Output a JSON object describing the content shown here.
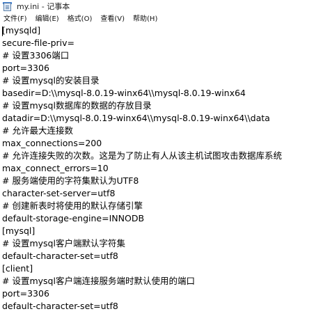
{
  "window": {
    "title": "my.ini - 记事本",
    "icon": "notepad-icon"
  },
  "menu": {
    "items": [
      "文件(F)",
      "编辑(E)",
      "格式(O)",
      "查看(V)",
      "帮助(H)"
    ]
  },
  "editor": {
    "lines": [
      "[mysqld]",
      "secure-file-priv=",
      "# 设置3306端口",
      "port=3306",
      "# 设置mysql的安装目录",
      "basedir=D:\\\\mysql-8.0.19-winx64\\\\mysql-8.0.19-winx64",
      "# 设置mysql数据库的数据的存放目录",
      "datadir=D:\\\\mysql-8.0.19-winx64\\\\mysql-8.0.19-winx64\\\\data",
      "# 允许最大连接数",
      "max_connections=200",
      "# 允许连接失败的次数。这是为了防止有人从该主机试图攻击数据库系统",
      "max_connect_errors=10",
      "# 服务端使用的字符集默认为UTF8",
      "character-set-server=utf8",
      "# 创建新表时将使用的默认存储引擎",
      "default-storage-engine=INNODB",
      "[mysql]",
      "# 设置mysql客户端默认字符集",
      "default-character-set=utf8",
      "[client]",
      "# 设置mysql客户端连接服务端时默认使用的端口",
      "port=3306",
      "default-character-set=utf8"
    ]
  }
}
